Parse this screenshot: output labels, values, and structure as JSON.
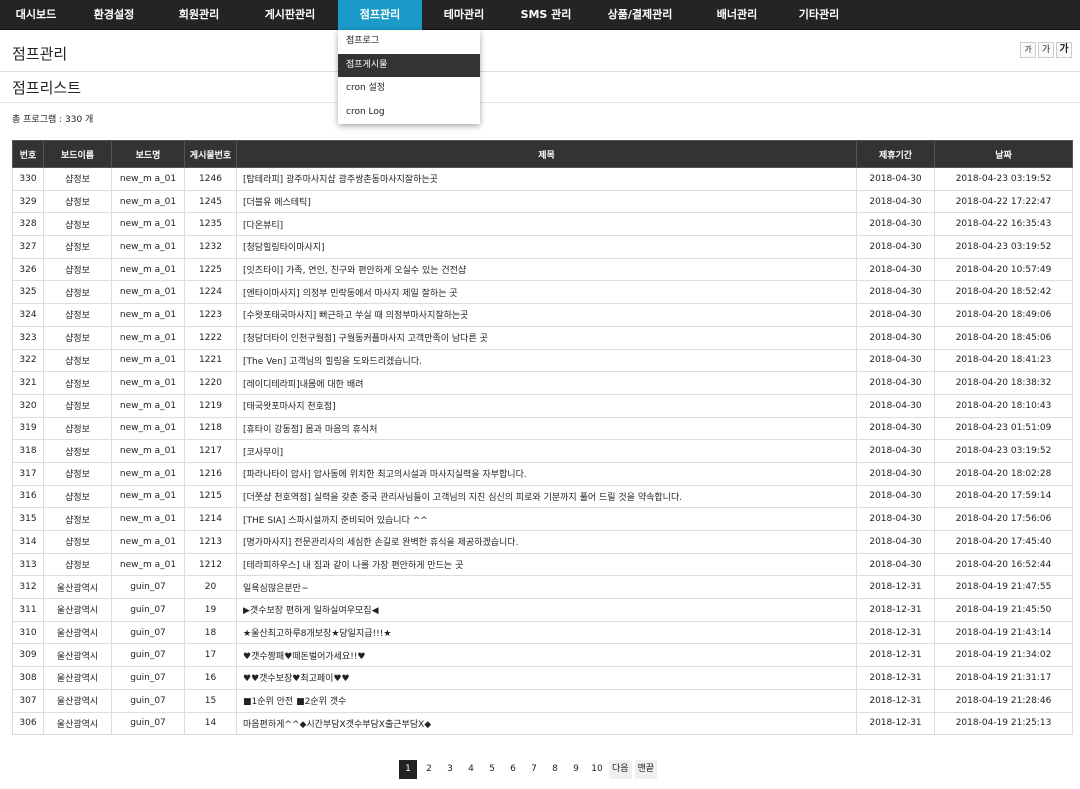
{
  "nav": {
    "items": [
      {
        "label": "대시보드",
        "w": 72
      },
      {
        "label": "환경설정",
        "w": 84
      },
      {
        "label": "회원관리",
        "w": 86
      },
      {
        "label": "게시판관리",
        "w": 96
      },
      {
        "label": "점프관리",
        "w": 84
      },
      {
        "label": "테마관리",
        "w": 84
      },
      {
        "label": "SMS 관리",
        "w": 80
      },
      {
        "label": "상품/결제관리",
        "w": 108
      },
      {
        "label": "배너관리",
        "w": 86
      },
      {
        "label": "기타관리",
        "w": 78
      }
    ]
  },
  "dropdown": {
    "items": [
      "점프로그",
      "점프게시물",
      "cron 설정",
      "cron Log"
    ]
  },
  "header": {
    "title": "점프관리",
    "font_small": "가",
    "font_medium": "가",
    "font_large": "가"
  },
  "sub": {
    "title": "점프리스트"
  },
  "total": "총 프로그램 : 330 개",
  "table": {
    "headers": [
      "번호",
      "보드이름",
      "보드명",
      "게시물번호",
      "제목",
      "제휴기간",
      "날짜"
    ],
    "rows": [
      [
        "330",
        "샵정보",
        "new_m a_01",
        "1246",
        "[탑테라피] 광주마사지샵 광주쌍촌동마사지잘하는곳",
        "2018-04-30",
        "2018-04-23 03:19:52"
      ],
      [
        "329",
        "샵정보",
        "new_m a_01",
        "1245",
        "[더블유 에스테틱]",
        "2018-04-30",
        "2018-04-22 17:22:47"
      ],
      [
        "328",
        "샵정보",
        "new_m a_01",
        "1235",
        "[다온뷰티]",
        "2018-04-30",
        "2018-04-22 16:35:43"
      ],
      [
        "327",
        "샵정보",
        "new_m a_01",
        "1232",
        "[청담힐링타이마사지]",
        "2018-04-30",
        "2018-04-23 03:19:52"
      ],
      [
        "326",
        "샵정보",
        "new_m a_01",
        "1225",
        "[잇츠타이] 가족, 연인, 친구와 편안하게 오실수 있는 건전샵",
        "2018-04-30",
        "2018-04-20 10:57:49"
      ],
      [
        "325",
        "샵정보",
        "new_m a_01",
        "1224",
        "[엔타이마사지] 의정부 민락동에서 마사지 제일 잘하는 곳",
        "2018-04-30",
        "2018-04-20 18:52:42"
      ],
      [
        "324",
        "샵정보",
        "new_m a_01",
        "1223",
        "[수왓포태국마사지] 뻐근하고 쑤실 때 의정부마사지잘하는곳",
        "2018-04-30",
        "2018-04-20 18:49:06"
      ],
      [
        "323",
        "샵정보",
        "new_m a_01",
        "1222",
        "[청담더타이 인천구월점] 구월동커플마사지 고객만족이 남다른 곳",
        "2018-04-30",
        "2018-04-20 18:45:06"
      ],
      [
        "322",
        "샵정보",
        "new_m a_01",
        "1221",
        "[The Ven] 고객님의 힐링을 도와드리겠습니다.",
        "2018-04-30",
        "2018-04-20 18:41:23"
      ],
      [
        "321",
        "샵정보",
        "new_m a_01",
        "1220",
        "[레이디테라피]내몸에 대한 배려",
        "2018-04-30",
        "2018-04-20 18:38:32"
      ],
      [
        "320",
        "샵정보",
        "new_m a_01",
        "1219",
        "[태국왓포마사지 천호점]",
        "2018-04-30",
        "2018-04-20 18:10:43"
      ],
      [
        "319",
        "샵정보",
        "new_m a_01",
        "1218",
        "[휴타이 강동점] 몸과 마음의 휴식처",
        "2018-04-30",
        "2018-04-23 01:51:09"
      ],
      [
        "318",
        "샵정보",
        "new_m a_01",
        "1217",
        "[코사무이]",
        "2018-04-30",
        "2018-04-23 03:19:52"
      ],
      [
        "317",
        "샵정보",
        "new_m a_01",
        "1216",
        "[파라나타이 압사] 압사동에 위치한 최고의시설과 마사지실력을 자부합니다.",
        "2018-04-30",
        "2018-04-20 18:02:28"
      ],
      [
        "316",
        "샵정보",
        "new_m a_01",
        "1215",
        "[더쭛샵 천호역점] 실력을 갖춘 중국 관리사님들이 고객님의 지친 심신의 피로와 기분까지 풀어 드릴 것을 약속합니다.",
        "2018-04-30",
        "2018-04-20 17:59:14"
      ],
      [
        "315",
        "샵정보",
        "new_m a_01",
        "1214",
        "[THE SIA] 스파시설까지 준비되어 있습니다 ^^",
        "2018-04-30",
        "2018-04-20 17:56:06"
      ],
      [
        "314",
        "샵정보",
        "new_m a_01",
        "1213",
        "[명가마사지] 전문관리사의 세심한 손길로 완벽한 휴식을 제공하겠습니다.",
        "2018-04-30",
        "2018-04-20 17:45:40"
      ],
      [
        "313",
        "샵정보",
        "new_m a_01",
        "1212",
        "[테라피하우스] 내 집과 같이 나를 가장 편안하게 만드는 곳",
        "2018-04-30",
        "2018-04-20 16:52:44"
      ],
      [
        "312",
        "울산광역시",
        "guin_07",
        "20",
        "일욕심많은분만~",
        "2018-12-31",
        "2018-04-19 21:47:55"
      ],
      [
        "311",
        "울산광역시",
        "guin_07",
        "19",
        "▶갯수보장 편하게 일하실여우모집◀",
        "2018-12-31",
        "2018-04-19 21:45:50"
      ],
      [
        "310",
        "울산광역시",
        "guin_07",
        "18",
        "★울산최고하루8개보장★당일지급!!!★",
        "2018-12-31",
        "2018-04-19 21:43:14"
      ],
      [
        "309",
        "울산광역시",
        "guin_07",
        "17",
        "♥갯수짱패♥떼돈벌어가세요!!♥",
        "2018-12-31",
        "2018-04-19 21:34:02"
      ],
      [
        "308",
        "울산광역시",
        "guin_07",
        "16",
        "♥♥갯수보장♥최고페이♥♥",
        "2018-12-31",
        "2018-04-19 21:31:17"
      ],
      [
        "307",
        "울산광역시",
        "guin_07",
        "15",
        "■1순위 안전 ■2순위 갯수",
        "2018-12-31",
        "2018-04-19 21:28:46"
      ],
      [
        "306",
        "울산광역시",
        "guin_07",
        "14",
        "마음편하게^^◆시간부담X갯수부담X출근부담X◆",
        "2018-12-31",
        "2018-04-19 21:25:13"
      ]
    ]
  },
  "pagination": {
    "pages": [
      "1",
      "2",
      "3",
      "4",
      "5",
      "6",
      "7",
      "8",
      "9",
      "10"
    ],
    "current": "1",
    "next": "다음",
    "last": "맨끝"
  }
}
